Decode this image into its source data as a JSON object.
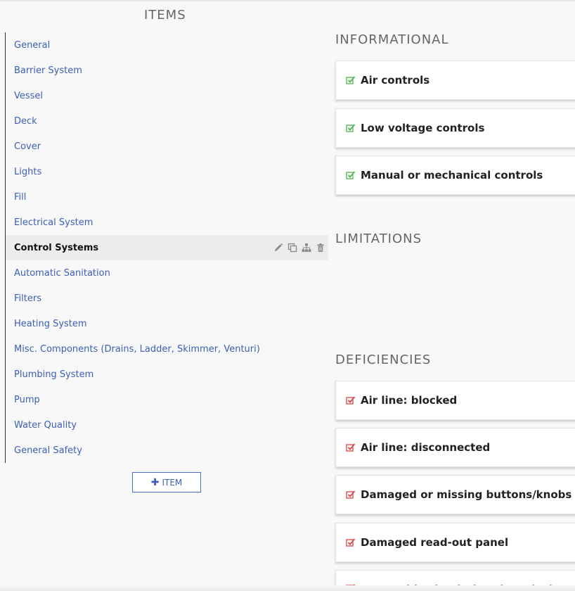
{
  "items_panel": {
    "title": "ITEMS",
    "items": [
      {
        "label": "General"
      },
      {
        "label": "Barrier System"
      },
      {
        "label": "Vessel"
      },
      {
        "label": "Deck"
      },
      {
        "label": "Cover"
      },
      {
        "label": "Lights"
      },
      {
        "label": "Fill"
      },
      {
        "label": "Electrical System"
      },
      {
        "label": "Control Systems",
        "active": true
      },
      {
        "label": "Automatic Sanitation"
      },
      {
        "label": "Filters"
      },
      {
        "label": "Heating System"
      },
      {
        "label": "Misc. Components (Drains, Ladder, Skimmer, Venturi)"
      },
      {
        "label": "Plumbing System"
      },
      {
        "label": "Pump"
      },
      {
        "label": "Water Quality"
      },
      {
        "label": "General Safety"
      }
    ],
    "active_item_actions": [
      "pencil-icon",
      "copy-icon",
      "sitemap-icon",
      "trash-icon"
    ],
    "add_button_label": "ITEM"
  },
  "informational": {
    "title": "INFORMATIONAL",
    "check_color": "#5cb85c",
    "entries": [
      "Air controls",
      "Low voltage controls",
      "Manual or mechanical controls"
    ]
  },
  "limitations": {
    "title": "LIMITATIONS",
    "entries": []
  },
  "deficiencies": {
    "title": "DEFICIENCIES",
    "check_color": "#d9534f",
    "entries": [
      "Air line: blocked",
      "Air line: disconnected",
      "Damaged or missing buttons/knobs",
      "Damaged read-out panel",
      "Inoperable circulation time clock"
    ]
  }
}
